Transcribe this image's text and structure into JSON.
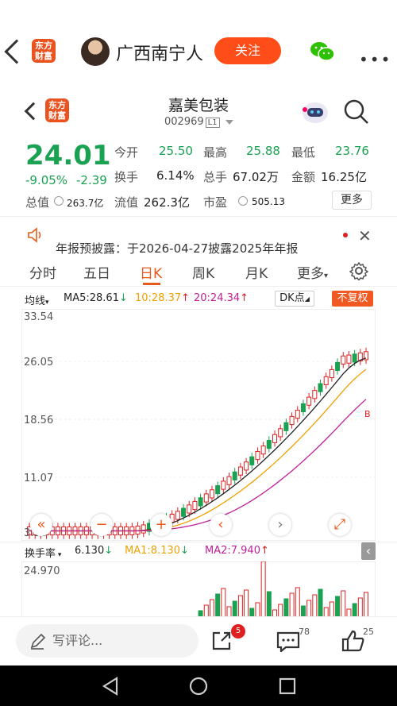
{
  "top": {
    "logo_lines": [
      "东方",
      "财富"
    ],
    "username": "广西南宁人",
    "follow_label": "关注"
  },
  "stock": {
    "logo_lines": [
      "东方",
      "财富"
    ],
    "name": "嘉美包装",
    "code": "002969",
    "level": "L1",
    "price": "24.01",
    "change_pct": "-9.05%",
    "change_abs": "-2.39",
    "open_label": "今开",
    "open": "25.50",
    "high_label": "最高",
    "high": "25.88",
    "low_label": "最低",
    "low": "23.76",
    "turnover_label": "换手",
    "turnover": "6.14%",
    "volume_label": "总手",
    "volume": "67.02万",
    "amount_label": "金额",
    "amount": "16.25亿",
    "mktcap_label": "总值",
    "mktcap": "263.7亿",
    "float_label": "流值",
    "float": "262.3亿",
    "pe_label": "市盈",
    "pe": "505.13",
    "more_label": "更多"
  },
  "banner": {
    "text": "年报预披露：于2026-04-27披露2025年年报"
  },
  "tabs": [
    "分时",
    "五日",
    "日K",
    "周K",
    "月K",
    "更多"
  ],
  "active_tab": 2,
  "ma": {
    "mode": "均线",
    "ma5": "MA5:28.61",
    "ma10": "10:28.37",
    "ma20": "20:24.34",
    "dk": "DK点",
    "fq": "不复权"
  },
  "y_labels": [
    "33.54",
    "26.05",
    "18.56",
    "11.07",
    "3.58"
  ],
  "sub": {
    "indicator": "换手率",
    "value": "6.130",
    "ma1": "MA1:8.130",
    "ma2": "MA2:7.940",
    "top_label": "24.970"
  },
  "footer": {
    "comment_placeholder": "写评论...",
    "share_badge": "5",
    "comment_count": "78",
    "like_count": "25"
  },
  "colors": {
    "accent": "#e85a1a",
    "down": "#1aa152",
    "up": "#e02020",
    "ma5": "#222222",
    "ma10": "#f0a000",
    "ma20": "#c0209a"
  }
}
